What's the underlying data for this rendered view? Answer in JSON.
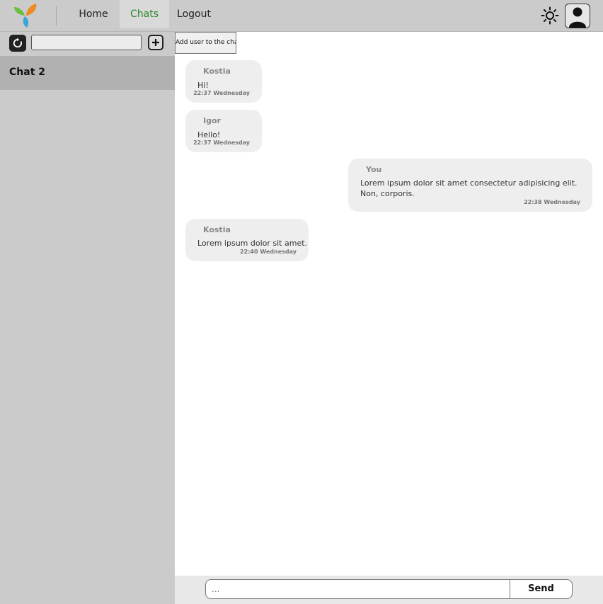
{
  "navbar": {
    "home_label": "Home",
    "chats_label": "Chats",
    "logout_label": "Logout",
    "active_color": "#2a8a2a"
  },
  "sidebar": {
    "search_value": "",
    "chats": [
      {
        "label": "Chat 2"
      }
    ]
  },
  "chat": {
    "add_user_label": "Add user to the chat",
    "messages": [
      {
        "author": "Kostia",
        "text": "Hi!",
        "time": "22:37 Wednesday",
        "mine": false
      },
      {
        "author": "Igor",
        "text": "Hello!",
        "time": "22:37 Wednesday",
        "mine": false
      },
      {
        "author": "You",
        "text": "Lorem ipsum dolor sit amet consectetur adipisicing elit. Non, corporis.",
        "time": "22:38 Wednesday",
        "mine": true
      },
      {
        "author": "Kostia",
        "text": "Lorem ipsum dolor sit amet.",
        "time": "22:40 Wednesday",
        "mine": false
      }
    ]
  },
  "composer": {
    "placeholder": "...",
    "send_label": "Send"
  },
  "icons": {
    "logo": "leaf-logo-icon",
    "theme": "sun-icon",
    "avatar": "user-avatar-icon",
    "refresh": "refresh-icon",
    "add": "plus-icon"
  }
}
